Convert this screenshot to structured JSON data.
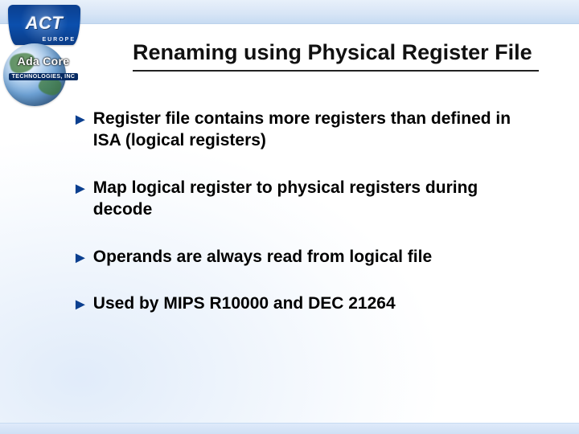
{
  "logo": {
    "main": "ACT",
    "sub": "EUROPE",
    "ada_title": "Ada Core",
    "ada_sub": "TECHNOLOGIES, INC"
  },
  "title": "Renaming using Physical Register File",
  "bullets": [
    "Register file contains more registers than defined in ISA (logical registers)",
    "Map logical register to physical registers during decode",
    "Operands are always read from logical file",
    "Used by MIPS R10000 and DEC 21264"
  ]
}
